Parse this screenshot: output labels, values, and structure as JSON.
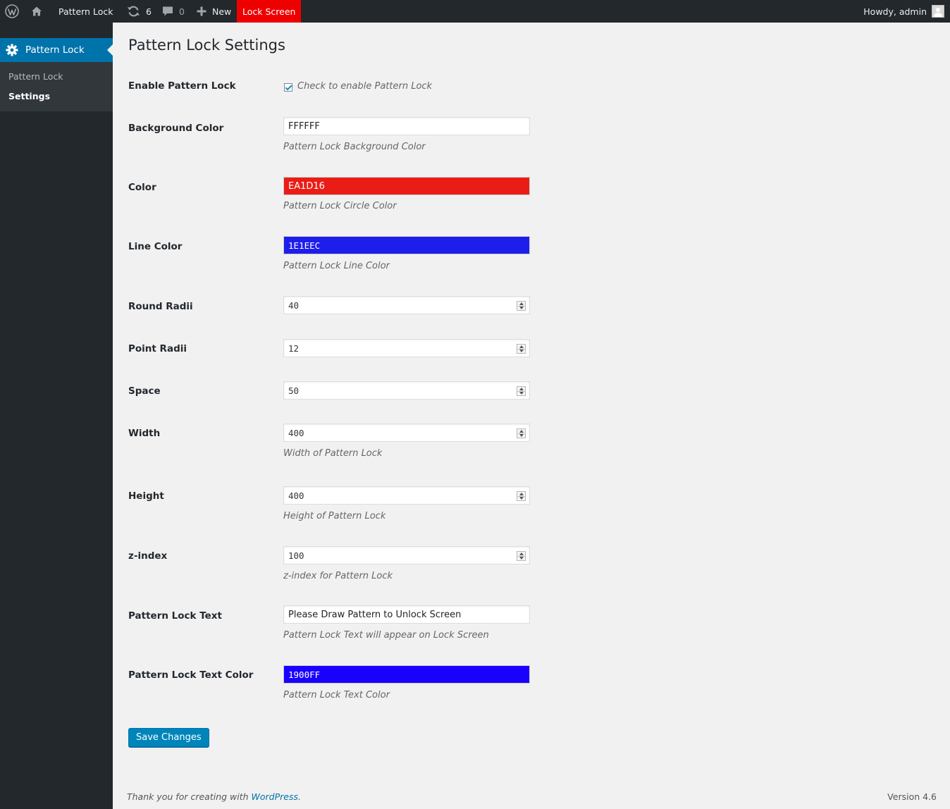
{
  "adminbar": {
    "site_name": "Pattern Lock",
    "updates_count": "6",
    "comments_count": "0",
    "new_label": "New",
    "lock_screen_label": "Lock Screen",
    "howdy": "Howdy, admin"
  },
  "sidebar": {
    "menu_label": "Pattern Lock",
    "submenu": [
      {
        "label": "Pattern Lock"
      },
      {
        "label": "Settings"
      }
    ]
  },
  "page": {
    "title": "Pattern Lock Settings",
    "fields": {
      "enable": {
        "label": "Enable Pattern Lock",
        "checkbox_label": "Check to enable Pattern Lock",
        "checked": true
      },
      "background_color": {
        "label": "Background Color",
        "value": "FFFFFF",
        "description": "Pattern Lock Background Color"
      },
      "color": {
        "label": "Color",
        "value": "EA1D16",
        "description": "Pattern Lock Circle Color"
      },
      "line_color": {
        "label": "Line Color",
        "value": "1E1EEC",
        "description": "Pattern Lock Line Color"
      },
      "round_radii": {
        "label": "Round Radii",
        "value": "40"
      },
      "point_radii": {
        "label": "Point Radii",
        "value": "12"
      },
      "space": {
        "label": "Space",
        "value": "50"
      },
      "width": {
        "label": "Width",
        "value": "400",
        "description": "Width of Pattern Lock"
      },
      "height": {
        "label": "Height",
        "value": "400",
        "description": "Height of Pattern Lock"
      },
      "z_index": {
        "label": "z-index",
        "value": "100",
        "description": "z-index for Pattern Lock"
      },
      "lock_text": {
        "label": "Pattern Lock Text",
        "value": "Please Draw Pattern to Unlock Screen",
        "description": "Pattern Lock Text will appear on Lock Screen"
      },
      "lock_text_color": {
        "label": "Pattern Lock Text Color",
        "value": "1900FF",
        "description": "Pattern Lock Text Color"
      }
    },
    "save_label": "Save Changes"
  },
  "footer": {
    "thanks_prefix": "Thank you for creating with",
    "wordpress_link": "WordPress",
    "thanks_suffix": ".",
    "version": "Version 4.6"
  },
  "colors": {
    "circle_color": "#EA1D16",
    "line_color": "#1E1EEC",
    "text_color": "#1900FF",
    "accent": "#0073aa",
    "lock_screen_badge": "#ee0000"
  }
}
